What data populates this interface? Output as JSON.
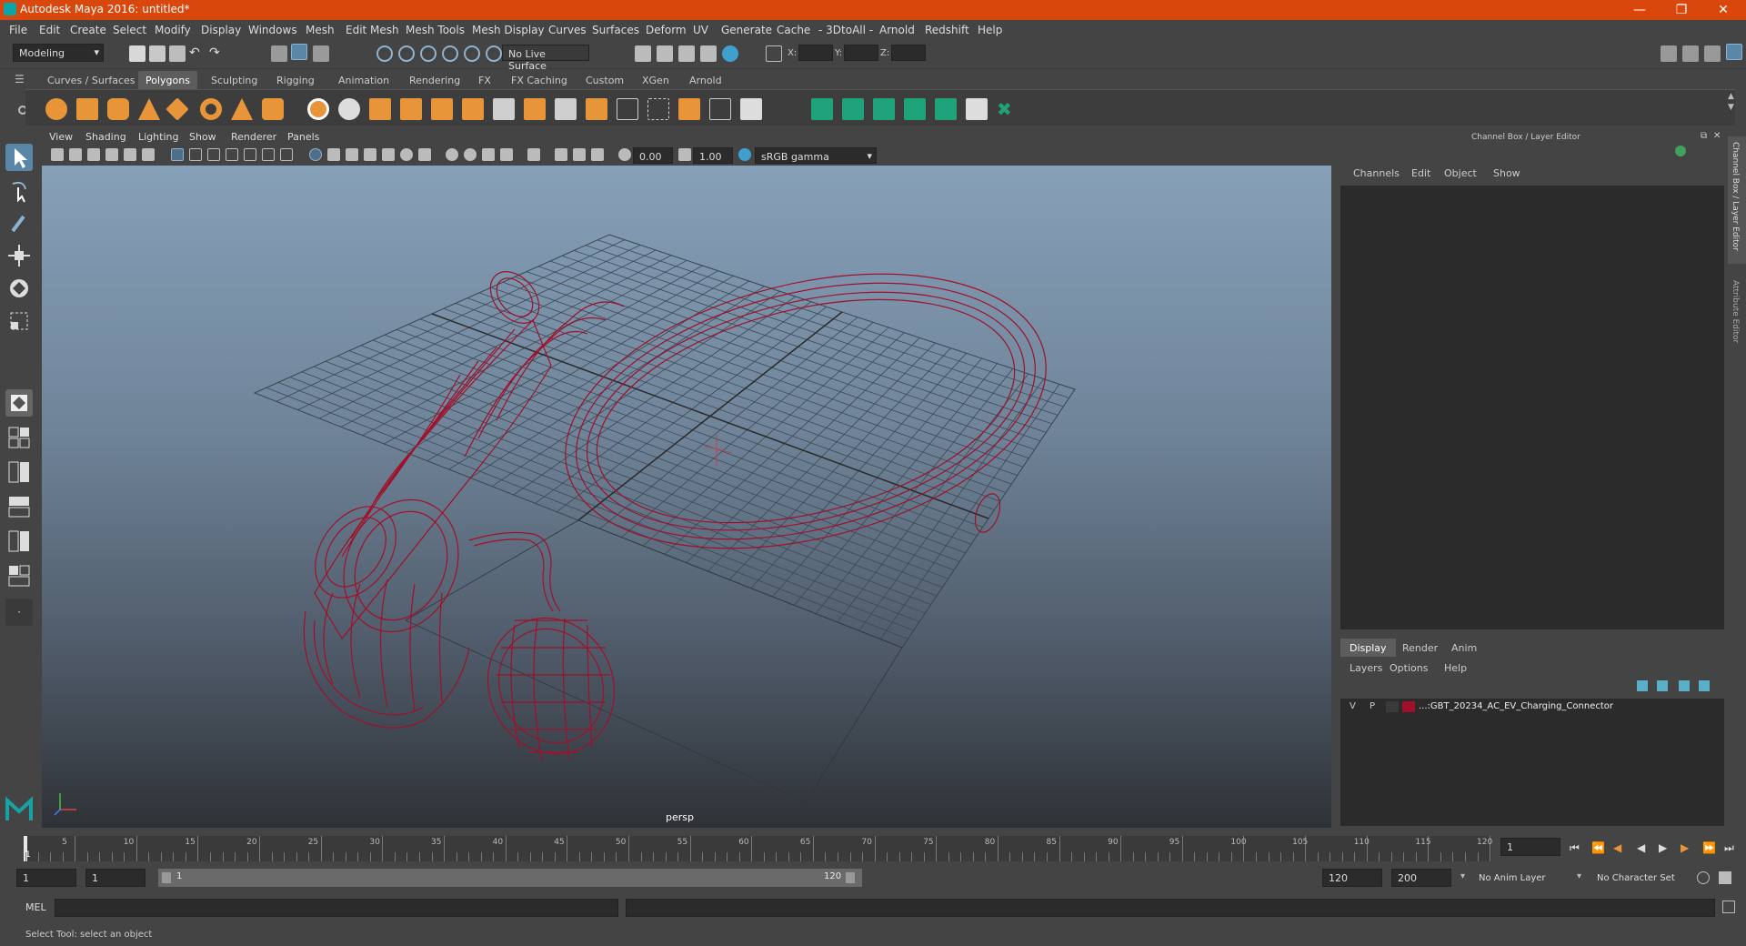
{
  "window": {
    "title": "Autodesk Maya 2016: untitled*",
    "minimize": "—",
    "restore": "❐",
    "close": "✕"
  },
  "menu": [
    "File",
    "Edit",
    "Create",
    "Select",
    "Modify",
    "Display",
    "Windows",
    "Mesh",
    "Edit Mesh",
    "Mesh Tools",
    "Mesh Display",
    "Curves",
    "Surfaces",
    "Deform",
    "UV",
    "Generate",
    "Cache",
    "- 3DtoAll -",
    "Arnold",
    "Redshift",
    "Help"
  ],
  "status": {
    "mode": "Modeling",
    "live_surface": "No Live Surface",
    "x_label": "X:",
    "y_label": "Y:",
    "z_label": "Z:"
  },
  "shelf_tabs": [
    "Curves / Surfaces",
    "Polygons",
    "Sculpting",
    "Rigging",
    "Animation",
    "Rendering",
    "FX",
    "FX Caching",
    "Custom",
    "XGen",
    "Arnold"
  ],
  "shelf_active": "Polygons",
  "viewport": {
    "menu": [
      "View",
      "Shading",
      "Lighting",
      "Show",
      "Renderer",
      "Panels"
    ],
    "exposure": "0.00",
    "gamma": "1.00",
    "colorspace": "sRGB gamma",
    "camera_label": "persp"
  },
  "channel_box": {
    "title": "Channel Box / Layer Editor",
    "menu": [
      "Channels",
      "Edit",
      "Object",
      "Show"
    ],
    "layer_tabs": [
      "Display",
      "Render",
      "Anim"
    ],
    "layer_menu": [
      "Layers",
      "Options",
      "Help"
    ],
    "layer": {
      "v": "V",
      "p": "P",
      "name": "...:GBT_20234_AC_EV_Charging_Connector",
      "color": "#a0102a"
    }
  },
  "side_tabs": [
    "Channel Box / Layer Editor",
    "Attribute Editor"
  ],
  "timeline": {
    "ticks": [
      "5",
      "10",
      "15",
      "20",
      "25",
      "30",
      "35",
      "40",
      "45",
      "50",
      "55",
      "60",
      "65",
      "70",
      "75",
      "80",
      "85",
      "90",
      "95",
      "100",
      "105",
      "110",
      "115",
      "120"
    ],
    "start_tick": "1",
    "current_frame": "1"
  },
  "range": {
    "start": "1",
    "anim_start": "1",
    "slider_start": "1",
    "slider_end": "120",
    "end": "120",
    "anim_end": "200",
    "anim_layer": "No Anim Layer",
    "char_set": "No Character Set"
  },
  "command": {
    "lang": "MEL"
  },
  "help_line": "Select Tool: select an object",
  "colors": {
    "wire": "#a0102a",
    "accent": "#d9470c"
  }
}
